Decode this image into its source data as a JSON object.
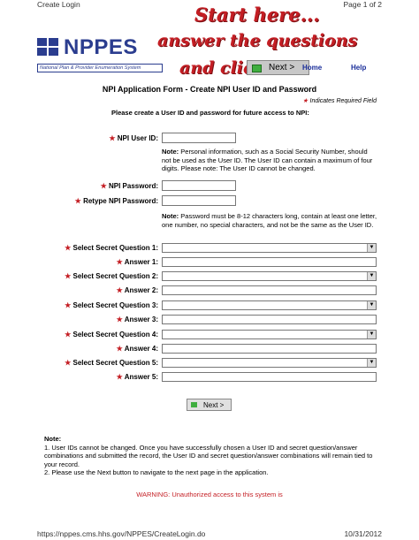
{
  "page_header": {
    "left": "Create Login",
    "right": "Page 1 of 2"
  },
  "page_footer": {
    "url": "https://nppes.cms.hhs.gov/NPPES/CreateLogin.do",
    "date": "10/31/2012"
  },
  "logo": {
    "word": "NPPES",
    "subtitle": "National Plan & Provider Enumeration System"
  },
  "callout": {
    "line1": "Start here...",
    "line2": "answer the questions",
    "line3": "and click"
  },
  "nav": {
    "next": "Next >",
    "home": "Home",
    "help": "Help"
  },
  "form": {
    "title": "NPI Application Form - Create NPI User ID and Password",
    "required_note": "Indicates Required Field",
    "instruction": "Please create a User ID and password for future access to NPI:",
    "user_id_label": "NPI User ID:",
    "user_id_note_bold": "Note:",
    "user_id_note": "Personal information, such as a Social Security Number, should not be used as the User ID. The User ID can contain a maximum of four digits. Please note: The User ID cannot be changed.",
    "password_label": "NPI Password:",
    "retype_label": "Retype NPI Password:",
    "password_note_bold": "Note:",
    "password_note": "Password must be 8-12 characters long, contain at least one letter, one number, no special characters, and not be the same as the User ID.",
    "questions": [
      {
        "q_label": "Select Secret Question 1:",
        "a_label": "Answer 1:"
      },
      {
        "q_label": "Select Secret Question 2:",
        "a_label": "Answer 2:"
      },
      {
        "q_label": "Select Secret Question 3:",
        "a_label": "Answer 3:"
      },
      {
        "q_label": "Select Secret Question 4:",
        "a_label": "Answer 4:"
      },
      {
        "q_label": "Select Secret Question 5:",
        "a_label": "Answer 5:"
      }
    ],
    "next_button": "Next >"
  },
  "bottom_note": {
    "heading": "Note:",
    "line1": "1. User IDs cannot be changed. Once you have successfully chosen a User ID and secret question/answer combinations and submitted the record, the User ID and secret question/answer combinations will remain tied to your record.",
    "line2": "2. Please use the Next button to navigate to the next page in the application."
  },
  "warning": "WARNING: Unauthorized access to this system is",
  "colors": {
    "accent_red": "#c41e24",
    "logo_blue": "#2b3d8f",
    "link_blue": "#1a2e9a"
  }
}
